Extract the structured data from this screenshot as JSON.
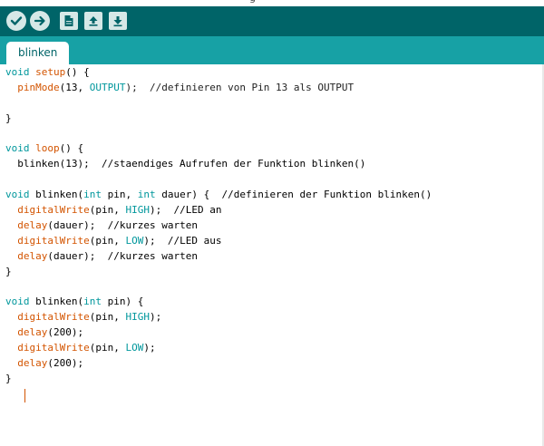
{
  "window": {
    "title_fragment": "g"
  },
  "colors": {
    "toolbar": "#006468",
    "tabbar": "#17a1a5",
    "keyword": "#00979c",
    "function": "#d35400"
  },
  "toolbar": {
    "buttons": [
      {
        "name": "verify",
        "icon": "check-icon"
      },
      {
        "name": "upload",
        "icon": "arrow-right-icon"
      },
      {
        "name": "new",
        "icon": "new-file-icon"
      },
      {
        "name": "open",
        "icon": "arrow-up-icon"
      },
      {
        "name": "save",
        "icon": "arrow-down-icon"
      }
    ]
  },
  "tabs": [
    {
      "label": "blinken",
      "active": true
    }
  ],
  "code_lines": [
    [
      {
        "t": "void",
        "c": "kw"
      },
      {
        "t": " "
      },
      {
        "t": "setup",
        "c": "fn"
      },
      {
        "t": "() {"
      }
    ],
    [
      {
        "t": "  "
      },
      {
        "t": "pinMode",
        "c": "fn"
      },
      {
        "t": "(13, "
      },
      {
        "t": "OUTPUT",
        "c": "const"
      },
      {
        "t": ");  //definieren von Pin 13 als OUTPUT",
        "c": "comment"
      }
    ],
    [],
    [
      {
        "t": "}"
      }
    ],
    [],
    [
      {
        "t": "void",
        "c": "kw"
      },
      {
        "t": " "
      },
      {
        "t": "loop",
        "c": "fn"
      },
      {
        "t": "() {"
      }
    ],
    [
      {
        "t": "  blinken(13);  //staendiges Aufrufen der Funktion blinken()"
      }
    ],
    [],
    [
      {
        "t": "void",
        "c": "kw"
      },
      {
        "t": " blinken("
      },
      {
        "t": "int",
        "c": "kw"
      },
      {
        "t": " pin, "
      },
      {
        "t": "int",
        "c": "kw"
      },
      {
        "t": " dauer) {  //definieren der Funktion blinken()"
      }
    ],
    [
      {
        "t": "  "
      },
      {
        "t": "digitalWrite",
        "c": "fn"
      },
      {
        "t": "(pin, "
      },
      {
        "t": "HIGH",
        "c": "const"
      },
      {
        "t": ");  //LED an"
      }
    ],
    [
      {
        "t": "  "
      },
      {
        "t": "delay",
        "c": "fn"
      },
      {
        "t": "(dauer);  //kurzes warten"
      }
    ],
    [
      {
        "t": "  "
      },
      {
        "t": "digitalWrite",
        "c": "fn"
      },
      {
        "t": "(pin, "
      },
      {
        "t": "LOW",
        "c": "const"
      },
      {
        "t": ");  //LED aus"
      }
    ],
    [
      {
        "t": "  "
      },
      {
        "t": "delay",
        "c": "fn"
      },
      {
        "t": "(dauer);  //kurzes warten"
      }
    ],
    [
      {
        "t": "}"
      }
    ],
    [],
    [
      {
        "t": "void",
        "c": "kw"
      },
      {
        "t": " blinken("
      },
      {
        "t": "int",
        "c": "kw"
      },
      {
        "t": " pin) {"
      }
    ],
    [
      {
        "t": "  "
      },
      {
        "t": "digitalWrite",
        "c": "fn"
      },
      {
        "t": "(pin, "
      },
      {
        "t": "HIGH",
        "c": "const"
      },
      {
        "t": ");"
      }
    ],
    [
      {
        "t": "  "
      },
      {
        "t": "delay",
        "c": "fn"
      },
      {
        "t": "(200);"
      }
    ],
    [
      {
        "t": "  "
      },
      {
        "t": "digitalWrite",
        "c": "fn"
      },
      {
        "t": "(pin, "
      },
      {
        "t": "LOW",
        "c": "const"
      },
      {
        "t": ");"
      }
    ],
    [
      {
        "t": "  "
      },
      {
        "t": "delay",
        "c": "fn"
      },
      {
        "t": "(200);"
      }
    ],
    [
      {
        "t": "}"
      }
    ]
  ]
}
